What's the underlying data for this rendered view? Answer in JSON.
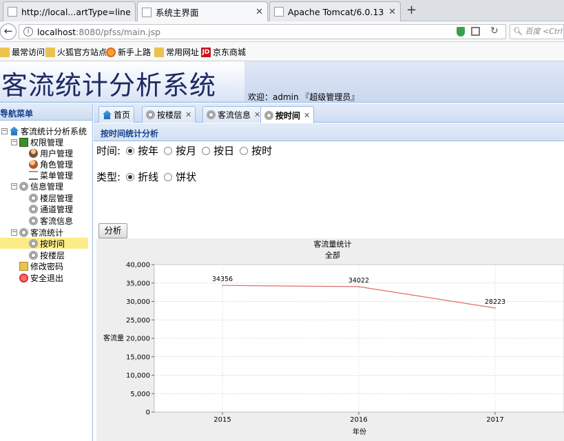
{
  "browser": {
    "tabs": [
      {
        "title": "http://local...artType=line"
      },
      {
        "title": "系统主界面"
      },
      {
        "title": "Apache Tomcat/6.0.13 - ..."
      }
    ],
    "new_tab": "+",
    "url_host": "localhost",
    "url_path": ":8080/pfss/main.jsp",
    "search_placeholder": "百度 <Ctrl+K>",
    "bookmarks": [
      "最常访问",
      "火狐官方站点",
      "新手上路",
      "常用网址",
      "京东商城"
    ],
    "bookmark_jd_badge": "JD"
  },
  "app": {
    "title": "客流统计分析系统",
    "welcome": "欢迎：admin 『超级管理员』"
  },
  "nav": {
    "header": "导航菜单",
    "collapse": "«",
    "root": "客流统计分析系统",
    "groups": [
      {
        "label": "权限管理",
        "items": [
          "用户管理",
          "角色管理",
          "菜单管理"
        ]
      },
      {
        "label": "信息管理",
        "items": [
          "楼层管理",
          "通道管理",
          "客流信息"
        ]
      },
      {
        "label": "客流统计",
        "items": [
          "按时间",
          "按楼层"
        ]
      }
    ],
    "extra": [
      "修改密码",
      "安全退出"
    ]
  },
  "content_tabs": [
    {
      "label": "首页",
      "closable": false
    },
    {
      "label": "按楼层",
      "closable": true
    },
    {
      "label": "客流信息",
      "closable": true
    },
    {
      "label": "按时间",
      "closable": true,
      "active": true
    }
  ],
  "panel": {
    "title": "按时间统计分析",
    "time_label": "时间:",
    "time_options": [
      {
        "label": "按年",
        "checked": true
      },
      {
        "label": "按月",
        "checked": false
      },
      {
        "label": "按日",
        "checked": false
      },
      {
        "label": "按时",
        "checked": false
      }
    ],
    "type_label": "类型:",
    "type_options": [
      {
        "label": "折线",
        "checked": true
      },
      {
        "label": "饼状",
        "checked": false
      }
    ],
    "analyze_button": "分析"
  },
  "chart_data": {
    "type": "line",
    "title": "客流量统计",
    "subtitle": "全部",
    "xlabel": "年份",
    "ylabel": "客流量",
    "categories": [
      "2015",
      "2016",
      "2017"
    ],
    "series": [
      {
        "values": [
          34356,
          34022,
          28223
        ],
        "color": "#e06a6a"
      }
    ],
    "data_labels": [
      "34356",
      "34022",
      "28223"
    ],
    "ylim": [
      0,
      40000
    ],
    "yticks": [
      "0",
      "5,000",
      "10,000",
      "15,000",
      "20,000",
      "25,000",
      "30,000",
      "35,000",
      "40,000"
    ],
    "grid": true
  }
}
